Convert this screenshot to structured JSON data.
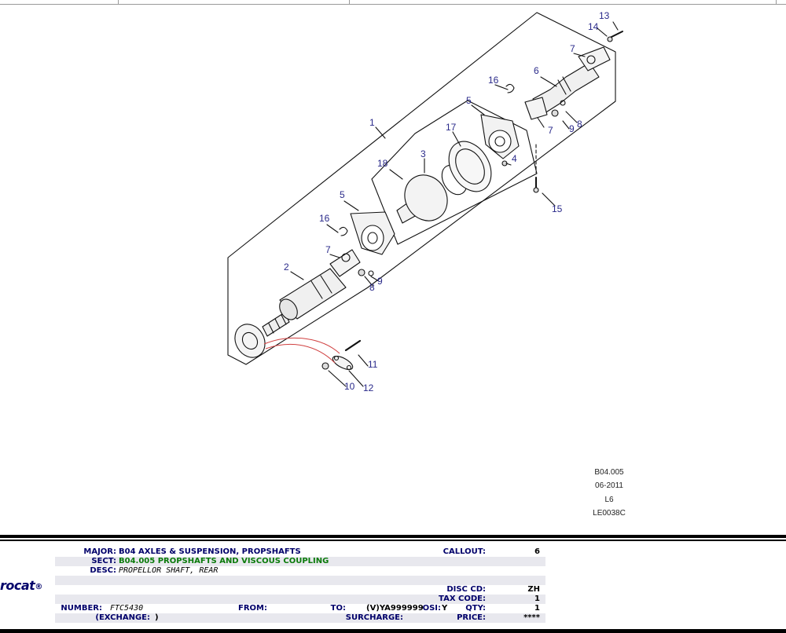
{
  "diagram": {
    "callouts": [
      "1",
      "2",
      "3",
      "4",
      "5",
      "5",
      "6",
      "7",
      "7",
      "7",
      "8",
      "8",
      "9",
      "9",
      "10",
      "11",
      "12",
      "13",
      "14",
      "15",
      "16",
      "16",
      "17",
      "18"
    ],
    "code": "B04.005",
    "date": "06-2011",
    "variant": "L6",
    "illustration_id": "LE0038C"
  },
  "info": {
    "major_label": "MAJOR:",
    "major_value": "B04  AXLES & SUSPENSION, PROPSHAFTS",
    "sect_label": "SECT:",
    "sect_value": "B04.005   PROPSHAFTS AND VISCOUS COUPLING",
    "desc_label": "DESC:",
    "desc_value": "PROPELLOR SHAFT, REAR",
    "number_label": "NUMBER:",
    "number_value": "FTC5430",
    "exchange_label": "(EXCHANGE:",
    "exchange_value": ")",
    "from_label": "FROM:",
    "to_label": "TO:",
    "to_value": "(V)YA999999",
    "osi_label": "OSI:",
    "osi_value": "Y",
    "surcharge_label": "SURCHARGE:",
    "callout_label": "CALLOUT:",
    "callout_value": "6",
    "disc_label": "DISC CD:",
    "disc_value": "ZH",
    "tax_label": "TAX CODE:",
    "tax_value": "1",
    "qty_label": "QTY:",
    "qty_value": "1",
    "price_label": "PRICE:",
    "price_value": "****"
  },
  "logo": {
    "text": "rocat",
    "mark": "®"
  },
  "colors": {
    "label_blue": "#00006a",
    "section_green": "#0a7a0a",
    "callout_blue": "#2a2a8a",
    "red_lines": "#d04040"
  }
}
